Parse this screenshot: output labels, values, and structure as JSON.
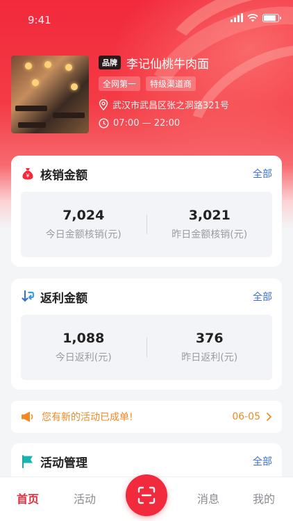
{
  "status_bar": {
    "time": "9:41"
  },
  "shop": {
    "brand_tag": "品牌",
    "name": "李记仙桃牛肉面",
    "tags": [
      "全网第一",
      "特级渠道商"
    ],
    "address": "武汉市武昌区张之洞路321号",
    "hours": "07:00 — 22:00"
  },
  "redeem": {
    "title": "核销金额",
    "all": "全部",
    "stats": [
      {
        "value": "7,024",
        "label": "今日金额核销(元)"
      },
      {
        "value": "3,021",
        "label": "昨日金额核销(元)"
      }
    ]
  },
  "rebate": {
    "title": "返利金额",
    "all": "全部",
    "stats": [
      {
        "value": "1,088",
        "label": "今日返利(元)"
      },
      {
        "value": "376",
        "label": "昨日返利(元)"
      }
    ]
  },
  "notice": {
    "text": "您有新的活动已成单!",
    "date": "06-05"
  },
  "activity": {
    "title": "活动管理",
    "all": "全部"
  },
  "tabbar": {
    "home": "首页",
    "activity": "活动",
    "messages": "消息",
    "mine": "我的"
  },
  "colors": {
    "brand_red": "#f12b3d",
    "link_blue": "#3b6fd4",
    "notice_orange": "#f08a24"
  }
}
